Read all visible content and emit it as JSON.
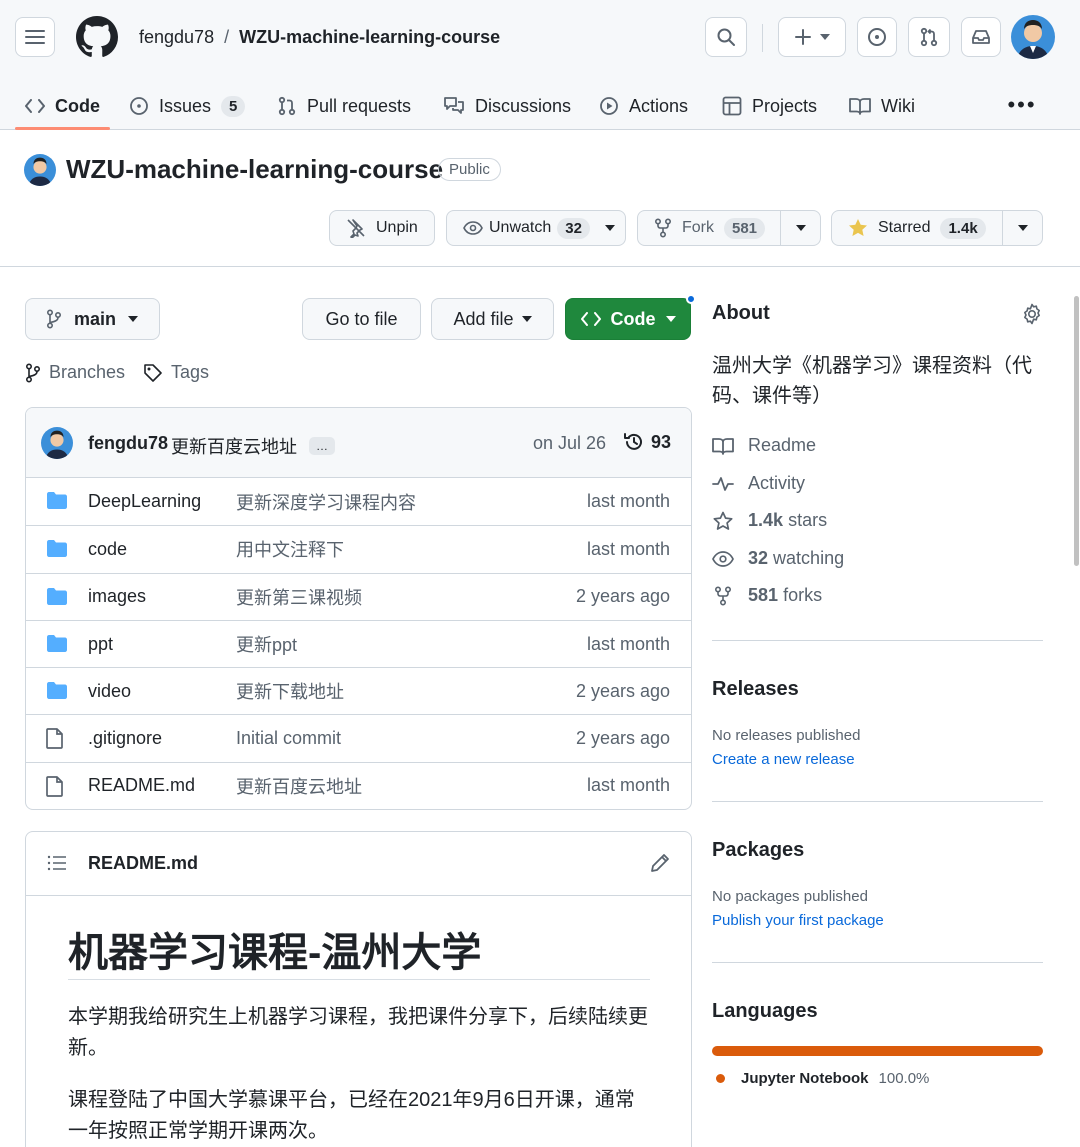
{
  "header": {
    "owner": "fengdu78",
    "separator": "/",
    "repo": "WZU-machine-learning-course"
  },
  "tabs": [
    {
      "label": "Code"
    },
    {
      "label": "Issues",
      "count": "5"
    },
    {
      "label": "Pull requests"
    },
    {
      "label": "Discussions"
    },
    {
      "label": "Actions"
    },
    {
      "label": "Projects"
    },
    {
      "label": "Wiki"
    }
  ],
  "tabs_more": "•••",
  "repo_head": {
    "title": "WZU-machine-learning-course",
    "visibility": "Public",
    "unpin_label": "Unpin",
    "watch_label": "Unwatch",
    "watch_count": "32",
    "fork_label": "Fork",
    "fork_count": "581",
    "star_label": "Starred",
    "star_count": "1.4k"
  },
  "toolbar": {
    "branch": "main",
    "goto_file": "Go to file",
    "add_file": "Add file",
    "code": "Code",
    "branches": "Branches",
    "tags": "Tags"
  },
  "commit": {
    "author": "fengdu78",
    "message": "更新百度云地址",
    "more": "…",
    "date": "on Jul 26",
    "count": "93"
  },
  "files": [
    {
      "type": "dir",
      "name": "DeepLearning",
      "message": "更新深度学习课程内容",
      "time": "last month"
    },
    {
      "type": "dir",
      "name": "code",
      "message": "用中文注释下",
      "time": "last month"
    },
    {
      "type": "dir",
      "name": "images",
      "message": "更新第三课视频",
      "time": "2 years ago"
    },
    {
      "type": "dir",
      "name": "ppt",
      "message": "更新ppt",
      "time": "last month"
    },
    {
      "type": "dir",
      "name": "video",
      "message": "更新下载地址",
      "time": "2 years ago"
    },
    {
      "type": "file",
      "name": ".gitignore",
      "message": "Initial commit",
      "time": "2 years ago"
    },
    {
      "type": "file",
      "name": "README.md",
      "message": "更新百度云地址",
      "time": "last month"
    }
  ],
  "readme": {
    "filename": "README.md",
    "heading": "机器学习课程-温州大学",
    "p1": "本学期我给研究生上机器学习课程，我把课件分享下，后续陆续更新。",
    "p2": "课程登陆了中国大学慕课平台，已经在2021年9月6日开课，通常一年按照正常学期开课两次。"
  },
  "about": {
    "title": "About",
    "description": "温州大学《机器学习》课程资料（代码、课件等）",
    "readme": "Readme",
    "activity": "Activity",
    "stars_count": "1.4k",
    "stars_label": "stars",
    "watching_count": "32",
    "watching_label": "watching",
    "forks_count": "581",
    "forks_label": "forks"
  },
  "releases": {
    "title": "Releases",
    "note": "No releases published",
    "link": "Create a new release"
  },
  "packages": {
    "title": "Packages",
    "note": "No packages published",
    "link": "Publish your first package"
  },
  "languages": {
    "title": "Languages",
    "items": [
      {
        "name": "Jupyter Notebook",
        "percent": "100.0%",
        "color": "#da5b0b",
        "share": 100
      }
    ]
  },
  "colors": {
    "accent": "#0969da",
    "primary_button": "#1f883d",
    "tab_underline": "#fd8c73",
    "folder": "#54aeff",
    "star": "#eac54f"
  }
}
